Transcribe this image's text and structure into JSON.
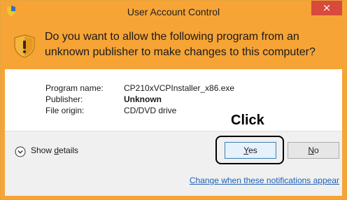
{
  "window": {
    "title": "User Account Control",
    "close_glyph": "×",
    "title_icon": "shield-icon"
  },
  "header": {
    "icon": "warning-shield-icon",
    "question": "Do you want to allow the following program from an unknown publisher to make changes to this computer?"
  },
  "info": {
    "program_name_label": "Program name:",
    "program_name_value": "CP210xVCPInstaller_x86.exe",
    "publisher_label": "Publisher:",
    "publisher_value": "Unknown",
    "file_origin_label": "File origin:",
    "file_origin_value": "CD/DVD drive"
  },
  "annotation": {
    "text": "Click"
  },
  "footer": {
    "details_icon": "chevron-down-circle-icon",
    "details_prefix": "Show ",
    "details_accel": "d",
    "details_suffix": "etails",
    "yes_accel": "Y",
    "yes_rest": "es",
    "no_accel": "N",
    "no_rest": "o",
    "link": "Change when these notifications appear"
  },
  "colors": {
    "accent": "#f6a436",
    "close": "#d84a3b",
    "link": "#1e60b5"
  }
}
